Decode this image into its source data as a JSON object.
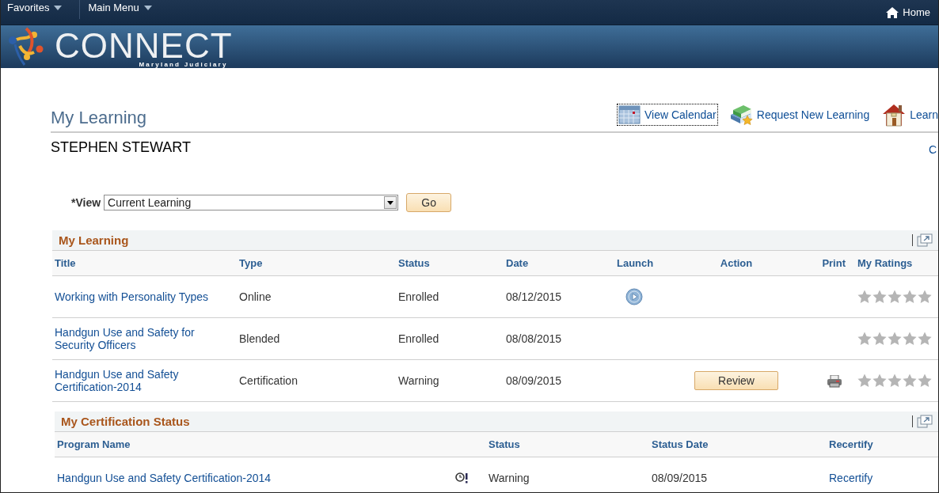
{
  "top_bar": {
    "menus": [
      {
        "label": "Favorites"
      },
      {
        "label": "Main Menu"
      }
    ],
    "home": "Home"
  },
  "banner": {
    "logo_text": "CONNECT",
    "logo_subtitle": "Maryland Judiciary"
  },
  "page": {
    "title": "My Learning",
    "links": [
      {
        "kind": "calendar",
        "label": "View Calendar",
        "focused": true
      },
      {
        "kind": "books",
        "label": "Request New Learning",
        "focused": false
      },
      {
        "kind": "house",
        "label": "Learn",
        "focused": false
      }
    ],
    "user_name": "STEPHEN STEWART",
    "right_link": "C"
  },
  "view_filter": {
    "label": "*View",
    "value": "Current Learning",
    "button": "Go"
  },
  "my_learning": {
    "title": "My Learning",
    "columns": [
      "Title",
      "Type",
      "Status",
      "Date",
      "Launch",
      "Action",
      "Print",
      "My Ratings"
    ],
    "rows": [
      {
        "title": "Working with Personality Types",
        "type": "Online",
        "status": "Enrolled",
        "date": "08/12/2015",
        "launch": true,
        "print": false,
        "stars": 0
      },
      {
        "title": "Handgun Use and Safety for Security Officers",
        "type": "Blended",
        "status": "Enrolled",
        "date": "08/08/2015",
        "launch": false,
        "print": false,
        "stars": 0
      },
      {
        "title": "Handgun Use and Safety Certification-2014",
        "type": "Certification",
        "status": "Warning",
        "date": "08/09/2015",
        "launch": false,
        "action": "Review",
        "print": true,
        "stars": 0
      }
    ]
  },
  "certification_status": {
    "title": "My Certification Status",
    "columns": [
      "Program Name",
      "Status",
      "Status Date",
      "Recertify"
    ],
    "rows": [
      {
        "program_name": "Handgun Use and Safety Certification-2014",
        "warning": true,
        "status": "Warning",
        "status_date": "08/09/2015",
        "recertify": "Recertify"
      }
    ]
  }
}
